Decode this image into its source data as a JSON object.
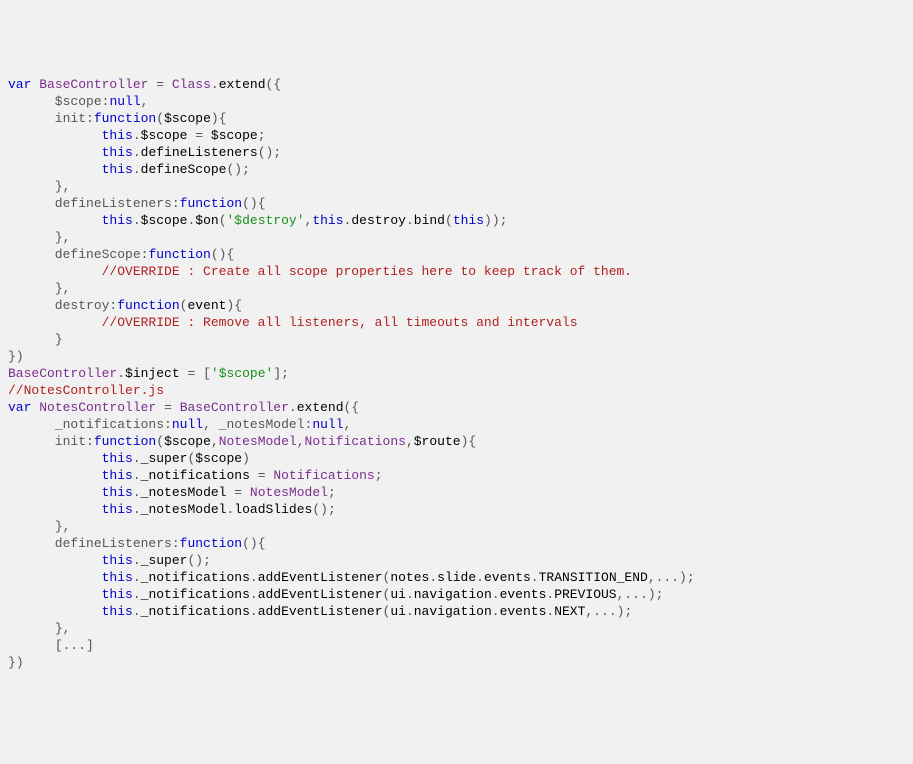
{
  "code": {
    "tokens": [
      [
        [
          "kw",
          "var"
        ],
        [
          "punc",
          " "
        ],
        [
          "cls",
          "BaseController"
        ],
        [
          "punc",
          " "
        ],
        [
          "op",
          "="
        ],
        [
          "punc",
          " "
        ],
        [
          "cls",
          "Class"
        ],
        [
          "op",
          "."
        ],
        [
          "id",
          "extend"
        ],
        [
          "paren",
          "("
        ],
        [
          "brace",
          "{"
        ]
      ],
      [
        [
          "punc",
          "      $scope"
        ],
        [
          "op",
          ":"
        ],
        [
          "kw",
          "null"
        ],
        [
          "op",
          ","
        ]
      ],
      [
        [
          "punc",
          "      init"
        ],
        [
          "op",
          ":"
        ],
        [
          "kw",
          "function"
        ],
        [
          "paren",
          "("
        ],
        [
          "id",
          "$scope"
        ],
        [
          "paren",
          ")"
        ],
        [
          "brace",
          "{"
        ]
      ],
      [
        [
          "punc",
          "            "
        ],
        [
          "kw",
          "this"
        ],
        [
          "op",
          "."
        ],
        [
          "id",
          "$scope"
        ],
        [
          "punc",
          " "
        ],
        [
          "op",
          "="
        ],
        [
          "punc",
          " "
        ],
        [
          "id",
          "$scope"
        ],
        [
          "op",
          ";"
        ]
      ],
      [
        [
          "punc",
          "            "
        ],
        [
          "kw",
          "this"
        ],
        [
          "op",
          "."
        ],
        [
          "id",
          "defineListeners"
        ],
        [
          "paren",
          "("
        ],
        [
          "paren",
          ")"
        ],
        [
          "op",
          ";"
        ]
      ],
      [
        [
          "punc",
          "            "
        ],
        [
          "kw",
          "this"
        ],
        [
          "op",
          "."
        ],
        [
          "id",
          "defineScope"
        ],
        [
          "paren",
          "("
        ],
        [
          "paren",
          ")"
        ],
        [
          "op",
          ";"
        ]
      ],
      [
        [
          "punc",
          "      "
        ],
        [
          "brace",
          "}"
        ],
        [
          "op",
          ","
        ]
      ],
      [
        [
          "punc",
          "      defineListeners"
        ],
        [
          "op",
          ":"
        ],
        [
          "kw",
          "function"
        ],
        [
          "paren",
          "("
        ],
        [
          "paren",
          ")"
        ],
        [
          "brace",
          "{"
        ]
      ],
      [
        [
          "punc",
          "            "
        ],
        [
          "kw",
          "this"
        ],
        [
          "op",
          "."
        ],
        [
          "id",
          "$scope"
        ],
        [
          "op",
          "."
        ],
        [
          "id",
          "$on"
        ],
        [
          "paren",
          "("
        ],
        [
          "str",
          "'$destroy'"
        ],
        [
          "op",
          ","
        ],
        [
          "kw",
          "this"
        ],
        [
          "op",
          "."
        ],
        [
          "id",
          "destroy"
        ],
        [
          "op",
          "."
        ],
        [
          "id",
          "bind"
        ],
        [
          "paren",
          "("
        ],
        [
          "kw",
          "this"
        ],
        [
          "paren",
          ")"
        ],
        [
          "paren",
          ")"
        ],
        [
          "op",
          ";"
        ]
      ],
      [
        [
          "punc",
          "      "
        ],
        [
          "brace",
          "}"
        ],
        [
          "op",
          ","
        ]
      ],
      [
        [
          "punc",
          "      defineScope"
        ],
        [
          "op",
          ":"
        ],
        [
          "kw",
          "function"
        ],
        [
          "paren",
          "("
        ],
        [
          "paren",
          ")"
        ],
        [
          "brace",
          "{"
        ]
      ],
      [
        [
          "punc",
          "            "
        ],
        [
          "cmt",
          "//OVERRIDE : Create all scope properties here to keep track of them."
        ]
      ],
      [
        [
          "punc",
          "      "
        ],
        [
          "brace",
          "}"
        ],
        [
          "op",
          ","
        ]
      ],
      [
        [
          "punc",
          "      destroy"
        ],
        [
          "op",
          ":"
        ],
        [
          "kw",
          "function"
        ],
        [
          "paren",
          "("
        ],
        [
          "id",
          "event"
        ],
        [
          "paren",
          ")"
        ],
        [
          "brace",
          "{"
        ]
      ],
      [
        [
          "punc",
          "            "
        ],
        [
          "cmt",
          "//OVERRIDE : Remove all listeners, all timeouts and intervals"
        ]
      ],
      [
        [
          "punc",
          "      "
        ],
        [
          "brace",
          "}"
        ]
      ],
      [
        [
          "brace",
          "}"
        ],
        [
          "paren",
          ")"
        ]
      ],
      [
        [
          "cls",
          "BaseController"
        ],
        [
          "op",
          "."
        ],
        [
          "id",
          "$inject"
        ],
        [
          "punc",
          " "
        ],
        [
          "op",
          "="
        ],
        [
          "punc",
          " "
        ],
        [
          "paren",
          "["
        ],
        [
          "str",
          "'$scope'"
        ],
        [
          "paren",
          "]"
        ],
        [
          "op",
          ";"
        ]
      ],
      [
        [
          "punc",
          ""
        ]
      ],
      [
        [
          "cmt",
          "//NotesController.js"
        ]
      ],
      [
        [
          "kw",
          "var"
        ],
        [
          "punc",
          " "
        ],
        [
          "cls",
          "NotesController"
        ],
        [
          "punc",
          " "
        ],
        [
          "op",
          "="
        ],
        [
          "punc",
          " "
        ],
        [
          "cls",
          "BaseController"
        ],
        [
          "op",
          "."
        ],
        [
          "id",
          "extend"
        ],
        [
          "paren",
          "("
        ],
        [
          "brace",
          "{"
        ]
      ],
      [
        [
          "punc",
          "      _notifications"
        ],
        [
          "op",
          ":"
        ],
        [
          "kw",
          "null"
        ],
        [
          "op",
          ","
        ],
        [
          "punc",
          " _notesModel"
        ],
        [
          "op",
          ":"
        ],
        [
          "kw",
          "null"
        ],
        [
          "op",
          ","
        ]
      ],
      [
        [
          "punc",
          "      init"
        ],
        [
          "op",
          ":"
        ],
        [
          "kw",
          "function"
        ],
        [
          "paren",
          "("
        ],
        [
          "id",
          "$scope"
        ],
        [
          "op",
          ","
        ],
        [
          "cls",
          "NotesModel"
        ],
        [
          "op",
          ","
        ],
        [
          "cls",
          "Notifications"
        ],
        [
          "op",
          ","
        ],
        [
          "id",
          "$route"
        ],
        [
          "paren",
          ")"
        ],
        [
          "brace",
          "{"
        ]
      ],
      [
        [
          "punc",
          "            "
        ],
        [
          "kw",
          "this"
        ],
        [
          "op",
          "."
        ],
        [
          "id",
          "_super"
        ],
        [
          "paren",
          "("
        ],
        [
          "id",
          "$scope"
        ],
        [
          "paren",
          ")"
        ]
      ],
      [
        [
          "punc",
          "            "
        ],
        [
          "kw",
          "this"
        ],
        [
          "op",
          "."
        ],
        [
          "id",
          "_notifications"
        ],
        [
          "punc",
          " "
        ],
        [
          "op",
          "="
        ],
        [
          "punc",
          " "
        ],
        [
          "cls",
          "Notifications"
        ],
        [
          "op",
          ";"
        ]
      ],
      [
        [
          "punc",
          "            "
        ],
        [
          "kw",
          "this"
        ],
        [
          "op",
          "."
        ],
        [
          "id",
          "_notesModel"
        ],
        [
          "punc",
          " "
        ],
        [
          "op",
          "="
        ],
        [
          "punc",
          " "
        ],
        [
          "cls",
          "NotesModel"
        ],
        [
          "op",
          ";"
        ]
      ],
      [
        [
          "punc",
          "            "
        ],
        [
          "kw",
          "this"
        ],
        [
          "op",
          "."
        ],
        [
          "id",
          "_notesModel"
        ],
        [
          "op",
          "."
        ],
        [
          "id",
          "loadSlides"
        ],
        [
          "paren",
          "("
        ],
        [
          "paren",
          ")"
        ],
        [
          "op",
          ";"
        ]
      ],
      [
        [
          "punc",
          "      "
        ],
        [
          "brace",
          "}"
        ],
        [
          "op",
          ","
        ]
      ],
      [
        [
          "punc",
          "      defineListeners"
        ],
        [
          "op",
          ":"
        ],
        [
          "kw",
          "function"
        ],
        [
          "paren",
          "("
        ],
        [
          "paren",
          ")"
        ],
        [
          "brace",
          "{"
        ]
      ],
      [
        [
          "punc",
          "            "
        ],
        [
          "kw",
          "this"
        ],
        [
          "op",
          "."
        ],
        [
          "id",
          "_super"
        ],
        [
          "paren",
          "("
        ],
        [
          "paren",
          ")"
        ],
        [
          "op",
          ";"
        ]
      ],
      [
        [
          "punc",
          "            "
        ],
        [
          "kw",
          "this"
        ],
        [
          "op",
          "."
        ],
        [
          "id",
          "_notifications"
        ],
        [
          "op",
          "."
        ],
        [
          "id",
          "addEventListener"
        ],
        [
          "paren",
          "("
        ],
        [
          "id",
          "notes"
        ],
        [
          "op",
          "."
        ],
        [
          "id",
          "slide"
        ],
        [
          "op",
          "."
        ],
        [
          "id",
          "events"
        ],
        [
          "op",
          "."
        ],
        [
          "id",
          "TRANSITION_END"
        ],
        [
          "op",
          ",..."
        ],
        [
          "paren",
          ")"
        ],
        [
          "op",
          ";"
        ]
      ],
      [
        [
          "punc",
          "            "
        ],
        [
          "kw",
          "this"
        ],
        [
          "op",
          "."
        ],
        [
          "id",
          "_notifications"
        ],
        [
          "op",
          "."
        ],
        [
          "id",
          "addEventListener"
        ],
        [
          "paren",
          "("
        ],
        [
          "id",
          "ui"
        ],
        [
          "op",
          "."
        ],
        [
          "id",
          "navigation"
        ],
        [
          "op",
          "."
        ],
        [
          "id",
          "events"
        ],
        [
          "op",
          "."
        ],
        [
          "id",
          "PREVIOUS"
        ],
        [
          "op",
          ",..."
        ],
        [
          "paren",
          ")"
        ],
        [
          "op",
          ";"
        ]
      ],
      [
        [
          "punc",
          "            "
        ],
        [
          "kw",
          "this"
        ],
        [
          "op",
          "."
        ],
        [
          "id",
          "_notifications"
        ],
        [
          "op",
          "."
        ],
        [
          "id",
          "addEventListener"
        ],
        [
          "paren",
          "("
        ],
        [
          "id",
          "ui"
        ],
        [
          "op",
          "."
        ],
        [
          "id",
          "navigation"
        ],
        [
          "op",
          "."
        ],
        [
          "id",
          "events"
        ],
        [
          "op",
          "."
        ],
        [
          "id",
          "NEXT"
        ],
        [
          "op",
          ",..."
        ],
        [
          "paren",
          ")"
        ],
        [
          "op",
          ";"
        ]
      ],
      [
        [
          "punc",
          "      "
        ],
        [
          "brace",
          "}"
        ],
        [
          "op",
          ","
        ]
      ],
      [
        [
          "punc",
          ""
        ]
      ],
      [
        [
          "punc",
          "      "
        ],
        [
          "paren",
          "["
        ],
        [
          "op",
          "..."
        ],
        [
          "paren",
          "]"
        ]
      ],
      [
        [
          "brace",
          "}"
        ],
        [
          "paren",
          ")"
        ]
      ]
    ]
  }
}
